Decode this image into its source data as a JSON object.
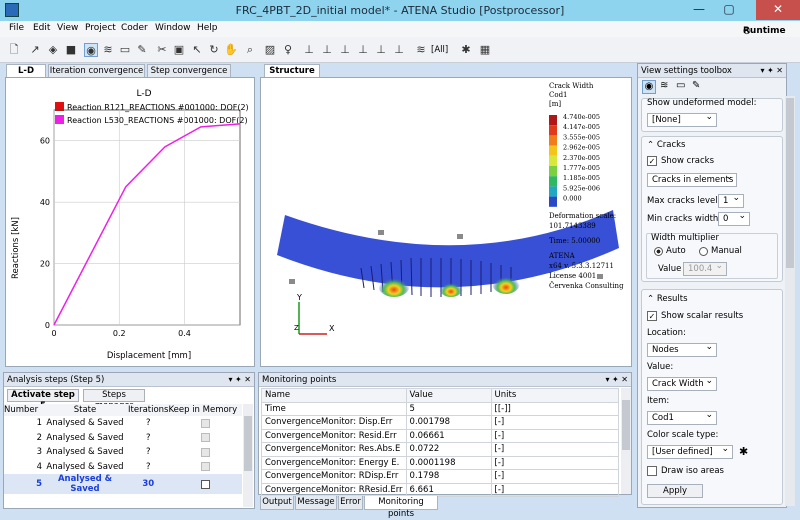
{
  "window": {
    "title": "FRC_4PBT_2D_initial model* - ATENA Studio [Postprocessor]",
    "minimize": "—",
    "maximize": "▢",
    "close": "✕"
  },
  "menu": [
    "File",
    "Edit",
    "View",
    "Project",
    "Coder",
    "Window",
    "Help"
  ],
  "runtime_label": "Runtime",
  "toolbar": {
    "all_label": "[All]"
  },
  "left_tabs": [
    "L-D",
    "Iteration convergence",
    "Step convergence"
  ],
  "center_tab": "Structure",
  "chart_data": {
    "type": "line",
    "title": "L-D",
    "xlabel": "Displacement [mm]",
    "ylabel": "Reactions [kN]",
    "xlim": [
      0,
      0.57
    ],
    "ylim": [
      0,
      70
    ],
    "xticks": [
      "0",
      "0.2",
      "0.4"
    ],
    "xtick_values": [
      0,
      0.2,
      0.4
    ],
    "yticks": [
      "0",
      "20",
      "40",
      "60"
    ],
    "ytick_values": [
      0,
      20,
      40,
      60
    ],
    "grid": true,
    "legend_position": "top",
    "series": [
      {
        "name": "Reaction R121_REACTIONS #001000: DOF(2)",
        "color": "#e11010",
        "x": [],
        "y": []
      },
      {
        "name": "Reaction L530_REACTIONS #001000: DOF(2)",
        "color": "#ee20e8",
        "x": [
          0,
          0.0,
          0.22,
          0.34,
          0.45,
          0.57
        ],
        "y": [
          0,
          0,
          45,
          58,
          64.5,
          65.5
        ]
      }
    ]
  },
  "structure": {
    "legend_title1": "Crack Width",
    "legend_title2": "Cod1",
    "legend_unit": "[m]",
    "legend_values": [
      "4.740e-005",
      "4.147e-005",
      "3.555e-005",
      "2.962e-005",
      "2.370e-005",
      "1.777e-005",
      "1.185e-005",
      "5.925e-006",
      "0.000"
    ],
    "legend_colors": [
      "#b01818",
      "#e03a1a",
      "#f07d1a",
      "#f4c41a",
      "#d8e83a",
      "#7ad040",
      "#30b860",
      "#20a8c0",
      "#2848c8"
    ],
    "info": [
      "Deformation scale:",
      "101.7143389",
      "Time:  5.00000",
      "ATENA",
      "x64 v. 5.3.3.12711",
      "License 4001",
      "Červenka Consulting"
    ],
    "axis_y": "Y",
    "axis_x": "X",
    "axis_z": "Z"
  },
  "view_settings": {
    "title": "View settings toolbox",
    "show_undeformed_label": "Show undeformed model:",
    "undeformed_value": "[None]",
    "cracks_header": "Cracks",
    "show_cracks": "Show cracks",
    "cracks_mode": "Cracks in elements",
    "max_cracks_level_label": "Max cracks level",
    "max_cracks_level": "1",
    "min_cracks_width_label": "Min cracks width",
    "min_cracks_width": "0",
    "width_multiplier_label": "Width multiplier",
    "auto": "Auto",
    "manual": "Manual",
    "value_label": "Value",
    "value": "100.4",
    "results_header": "Results",
    "show_scalar": "Show scalar results",
    "location_label": "Location:",
    "location": "Nodes",
    "value2_label": "Value:",
    "value2": "Crack Width",
    "item_label": "Item:",
    "item": "Cod1",
    "color_scale_label": "Color scale type:",
    "color_scale": "[User defined]",
    "draw_iso": "Draw iso areas",
    "apply": "Apply"
  },
  "analysis": {
    "title": "Analysis steps (Step 5)",
    "activate_btn": "Activate step 5",
    "manager_btn": "Steps manager",
    "columns": [
      "Number",
      "State",
      "Iterations",
      "Keep in Memory"
    ],
    "rows": [
      {
        "n": "1",
        "state": "Analysed & Saved",
        "it": "?"
      },
      {
        "n": "2",
        "state": "Analysed & Saved",
        "it": "?"
      },
      {
        "n": "3",
        "state": "Analysed & Saved",
        "it": "?"
      },
      {
        "n": "4",
        "state": "Analysed & Saved",
        "it": "?"
      },
      {
        "n": "5",
        "state": "Analysed & Saved",
        "it": "30"
      }
    ]
  },
  "monitoring": {
    "title": "Monitoring points",
    "columns": [
      "Name",
      "Value",
      "Units"
    ],
    "rows": [
      {
        "name": "Time",
        "value": "5",
        "units": "[[-]]"
      },
      {
        "name": "ConvergenceMonitor: Disp.Err",
        "value": "0.001798",
        "units": "[-]"
      },
      {
        "name": "ConvergenceMonitor: Resid.Err",
        "value": "0.06661",
        "units": "[-]"
      },
      {
        "name": "ConvergenceMonitor: Res.Abs.E",
        "value": "0.0722",
        "units": "[-]"
      },
      {
        "name": "ConvergenceMonitor: Energy E.",
        "value": "0.0001198",
        "units": "[-]"
      },
      {
        "name": "ConvergenceMonitor: RDisp.Err",
        "value": "0.1798",
        "units": "[-]"
      },
      {
        "name": "ConvergenceMonitor: RResid.Err",
        "value": "6.661",
        "units": "[-]"
      }
    ],
    "bottom_tabs": [
      "Output",
      "Message",
      "Error",
      "Monitoring points"
    ]
  }
}
